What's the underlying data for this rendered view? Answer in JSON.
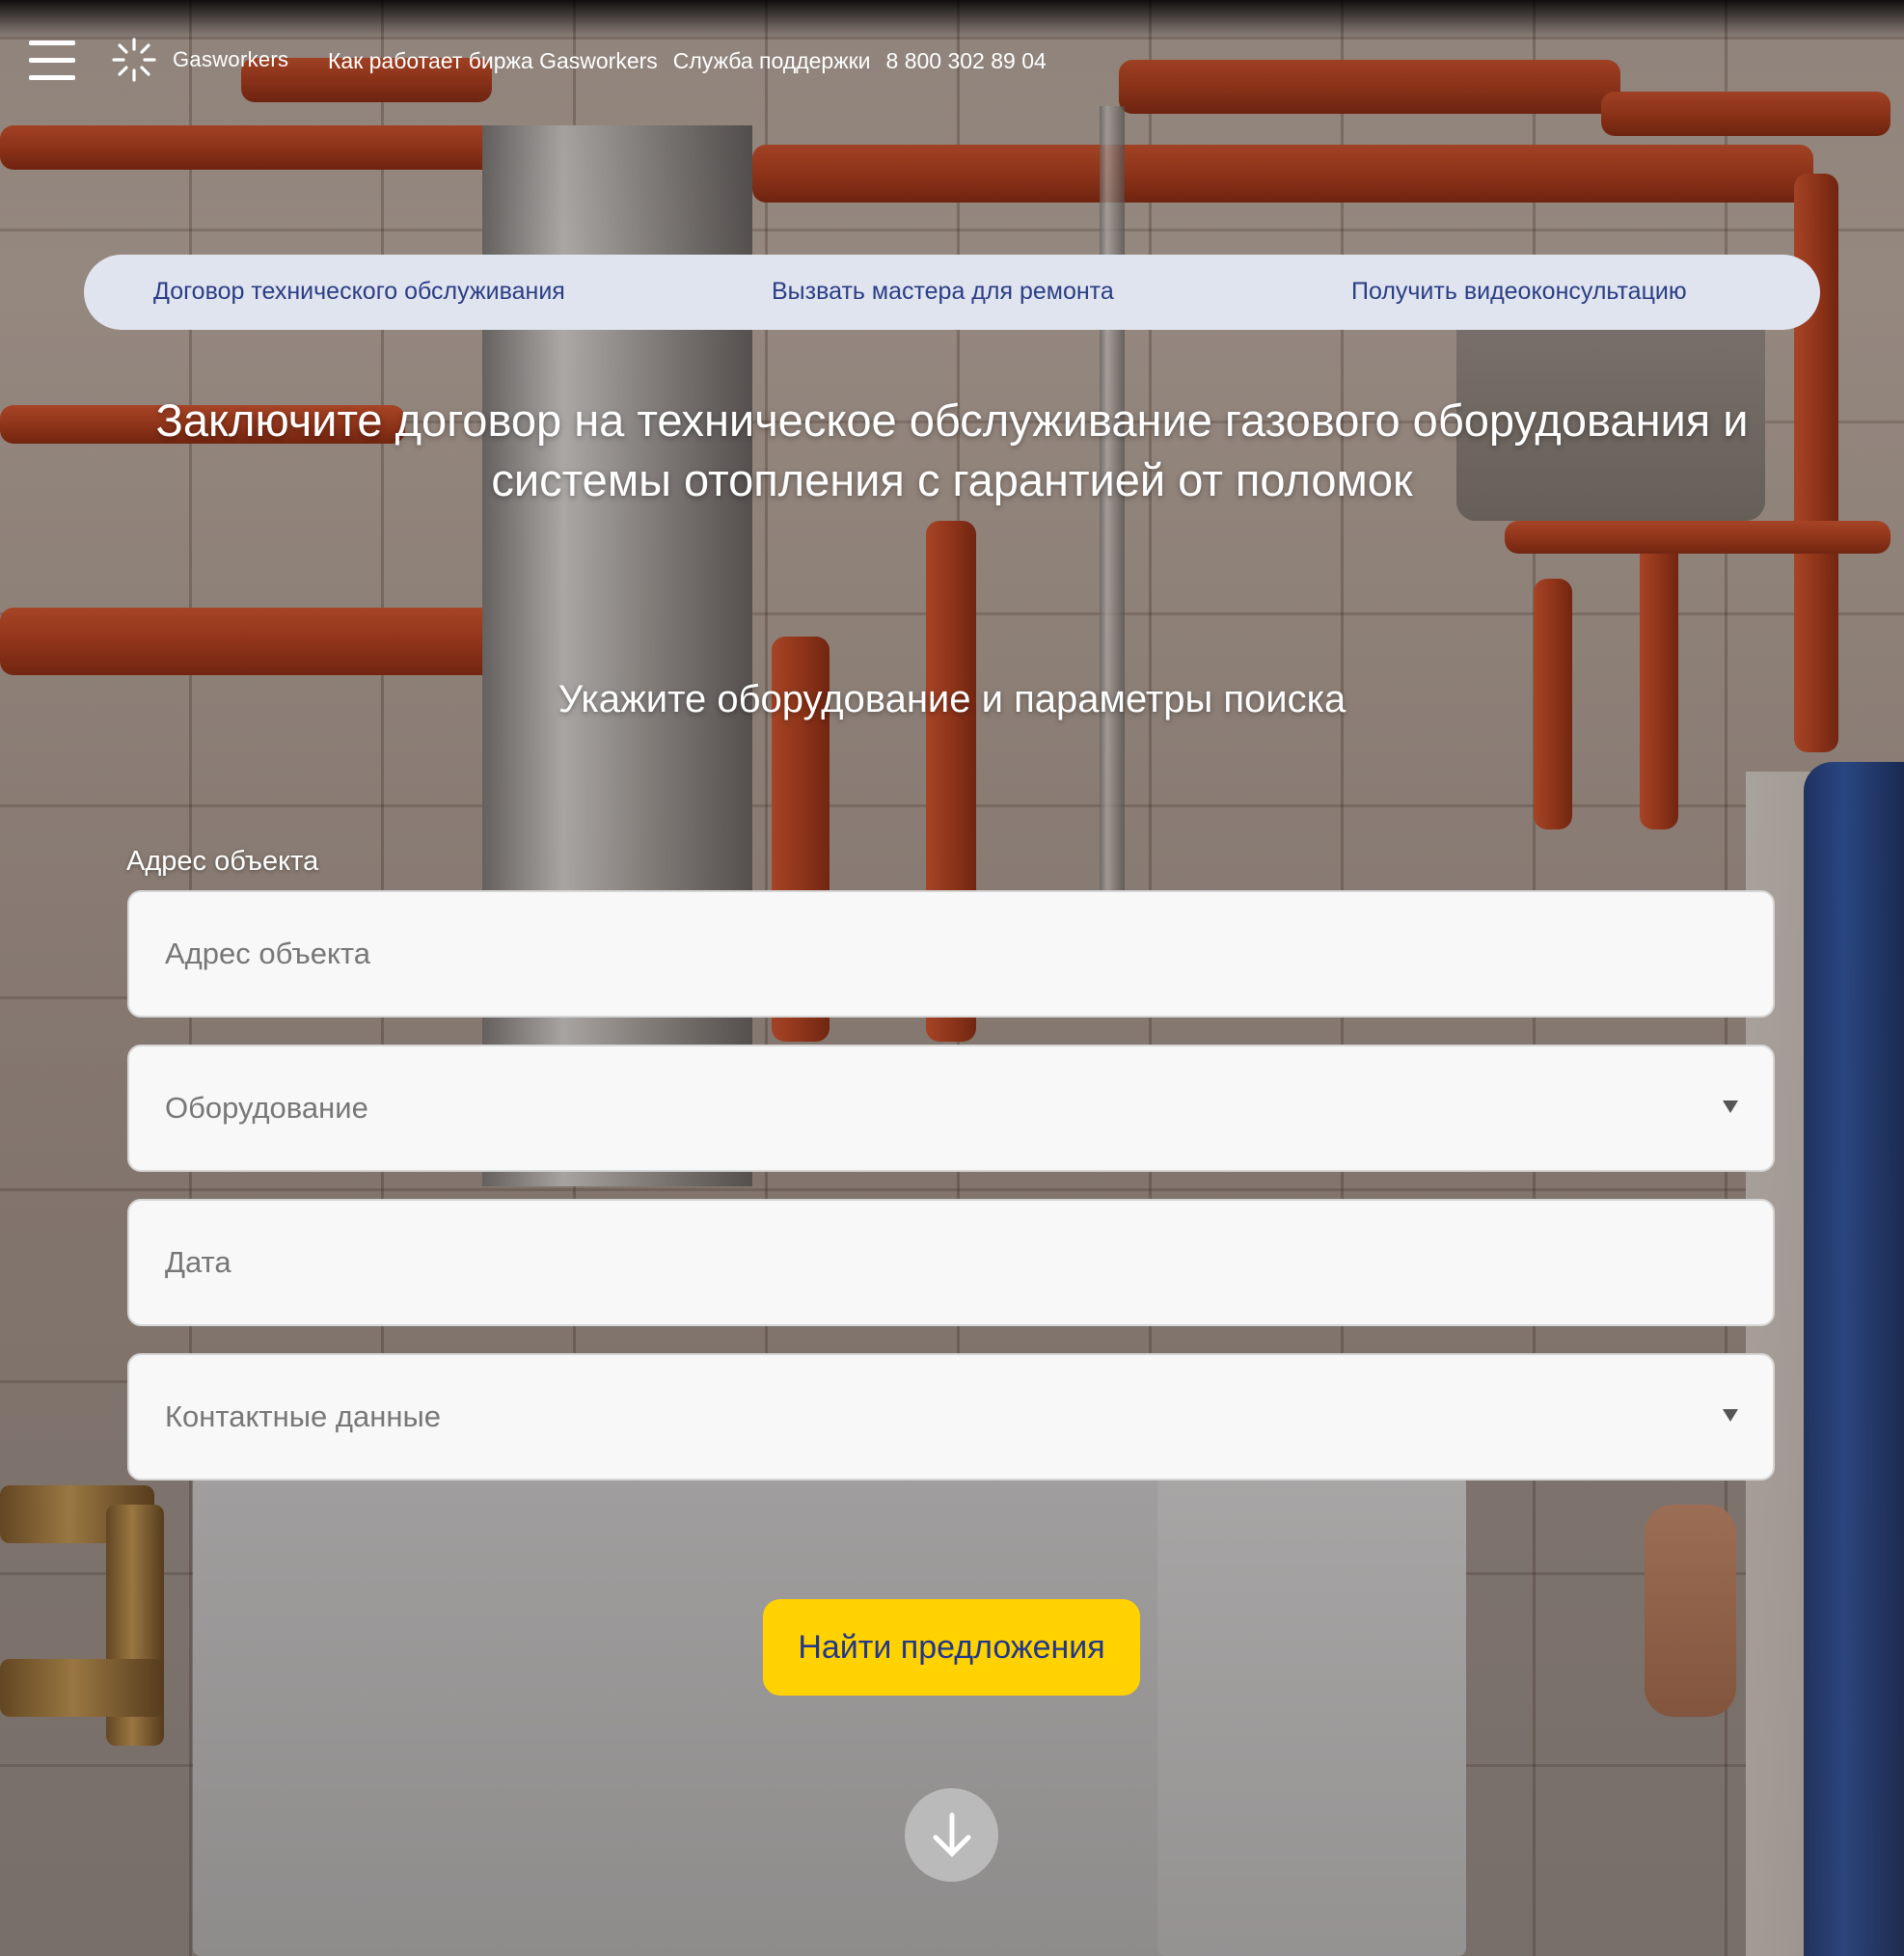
{
  "header": {
    "brand": "Gasworkers",
    "nav": [
      "Как работает биржа Gasworkers",
      "Служба поддержки",
      "8 800 302 89 04"
    ]
  },
  "tabs": [
    "Договор технического обслуживания",
    "Вызвать мастера для ремонта",
    "Получить видеоконсультацию"
  ],
  "hero": {
    "title": "Заключите договор на техническое обслуживание газового оборудования и системы отопления с гарантией от поломок",
    "subtitle": "Укажите оборудование и параметры поиска"
  },
  "form": {
    "address_label": "Адрес объекта",
    "address_placeholder": "Адрес объекта",
    "equipment_placeholder": "Оборудование",
    "date_placeholder": "Дата",
    "contacts_placeholder": "Контактные данные",
    "submit": "Найти предложения"
  },
  "icons": {
    "menu": "menu-icon",
    "logo": "sparkle-logo-icon",
    "dropdown": "chevron-down-icon",
    "scroll": "arrow-down-icon"
  },
  "colors": {
    "tabs_bg": "#dfe4ee",
    "tab_text": "#2b3d86",
    "button_bg": "#ffd200",
    "button_text": "#22378a"
  }
}
